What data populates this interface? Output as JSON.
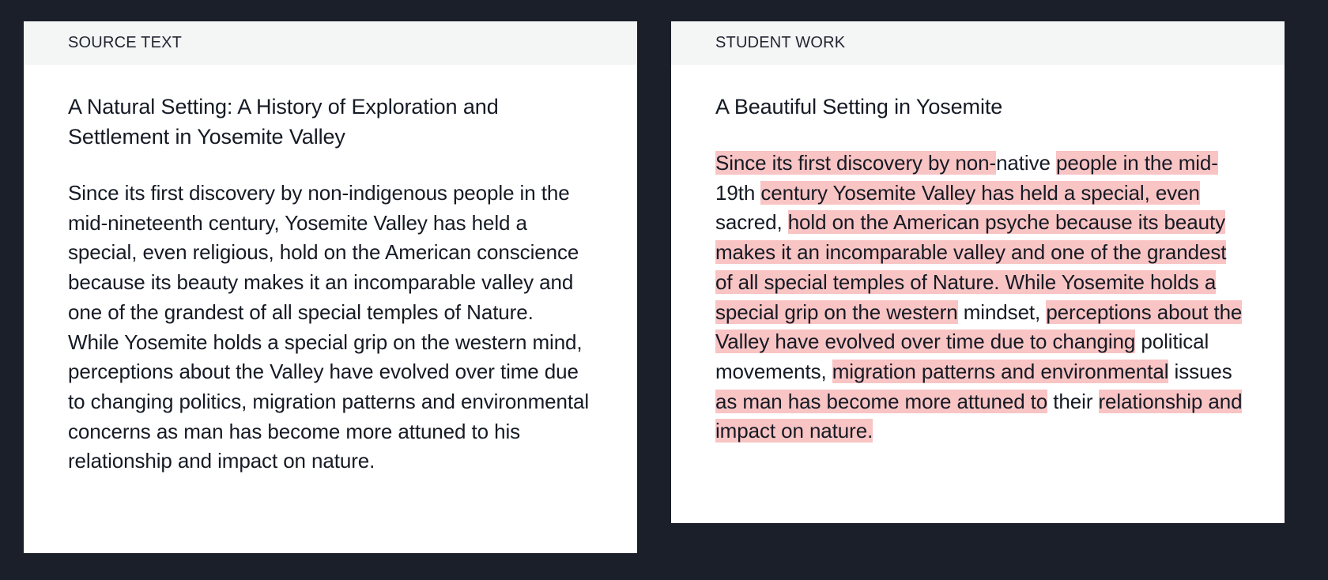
{
  "source": {
    "header": "SOURCE TEXT",
    "title": "A Natural Setting: A History of Exploration and Settlement in Yosemite Valley",
    "body": "Since its first discovery by non-indigenous people in the mid-nineteenth century, Yosemite Valley has held a special, even religious, hold on the American conscience because its beauty makes it an incomparable valley and one of the grandest of all special temples of Nature. While Yosemite holds a special grip on the western mind, perceptions about the Valley have evolved over time due to changing politics, migration patterns and environmental concerns as man has become more attuned to his relationship and impact on nature."
  },
  "student": {
    "header": "STUDENT WORK",
    "title": "A Beautiful Setting in Yosemite",
    "segments": [
      {
        "text": "Since its first discovery by non-",
        "highlight": true
      },
      {
        "text": "native ",
        "highlight": false
      },
      {
        "text": "people in the mid-",
        "highlight": true
      },
      {
        "text": "19th ",
        "highlight": false
      },
      {
        "text": "century Yosemite Valley has held a special, even",
        "highlight": true
      },
      {
        "text": " sacred, ",
        "highlight": false
      },
      {
        "text": "hold on the American psyche because its beauty makes it an incomparable valley and one of the grandest of all special temples of Nature. While Yosemite holds a special grip on the western",
        "highlight": true
      },
      {
        "text": " mindset, ",
        "highlight": false
      },
      {
        "text": "perceptions about the Valley have evolved over time due to changing",
        "highlight": true
      },
      {
        "text": " political movements, ",
        "highlight": false
      },
      {
        "text": "migration patterns and environmental",
        "highlight": true
      },
      {
        "text": " issues ",
        "highlight": false
      },
      {
        "text": "as man has become more attuned to",
        "highlight": true
      },
      {
        "text": " their ",
        "highlight": false
      },
      {
        "text": "relationship and impact on nature.",
        "highlight": true
      }
    ]
  },
  "colors": {
    "background": "#1b1f2a",
    "panel": "#ffffff",
    "header_bg": "#f4f5f5",
    "highlight": "#f9c4c4",
    "text": "#151a24"
  }
}
